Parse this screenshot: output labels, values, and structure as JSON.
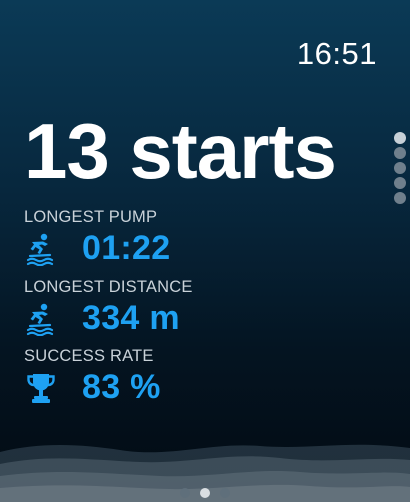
{
  "status": {
    "time": "16:51"
  },
  "summary": {
    "headline": "13 starts"
  },
  "stats": [
    {
      "label": "LONGEST PUMP",
      "value": "01:22",
      "icon": "surfer-icon"
    },
    {
      "label": "LONGEST DISTANCE",
      "value": "334 m",
      "icon": "surfer-icon"
    },
    {
      "label": "SUCCESS RATE",
      "value": "83 %",
      "icon": "trophy-icon"
    }
  ],
  "colors": {
    "accent": "#1ea1f2",
    "label": "#c9d2d9",
    "background_top": "#0b3a56",
    "background_bottom": "#020a12"
  },
  "vertical_page_indicator": {
    "count": 5,
    "active_index": 0
  },
  "horizontal_page_indicator": {
    "count": 3,
    "active_index": 1
  }
}
